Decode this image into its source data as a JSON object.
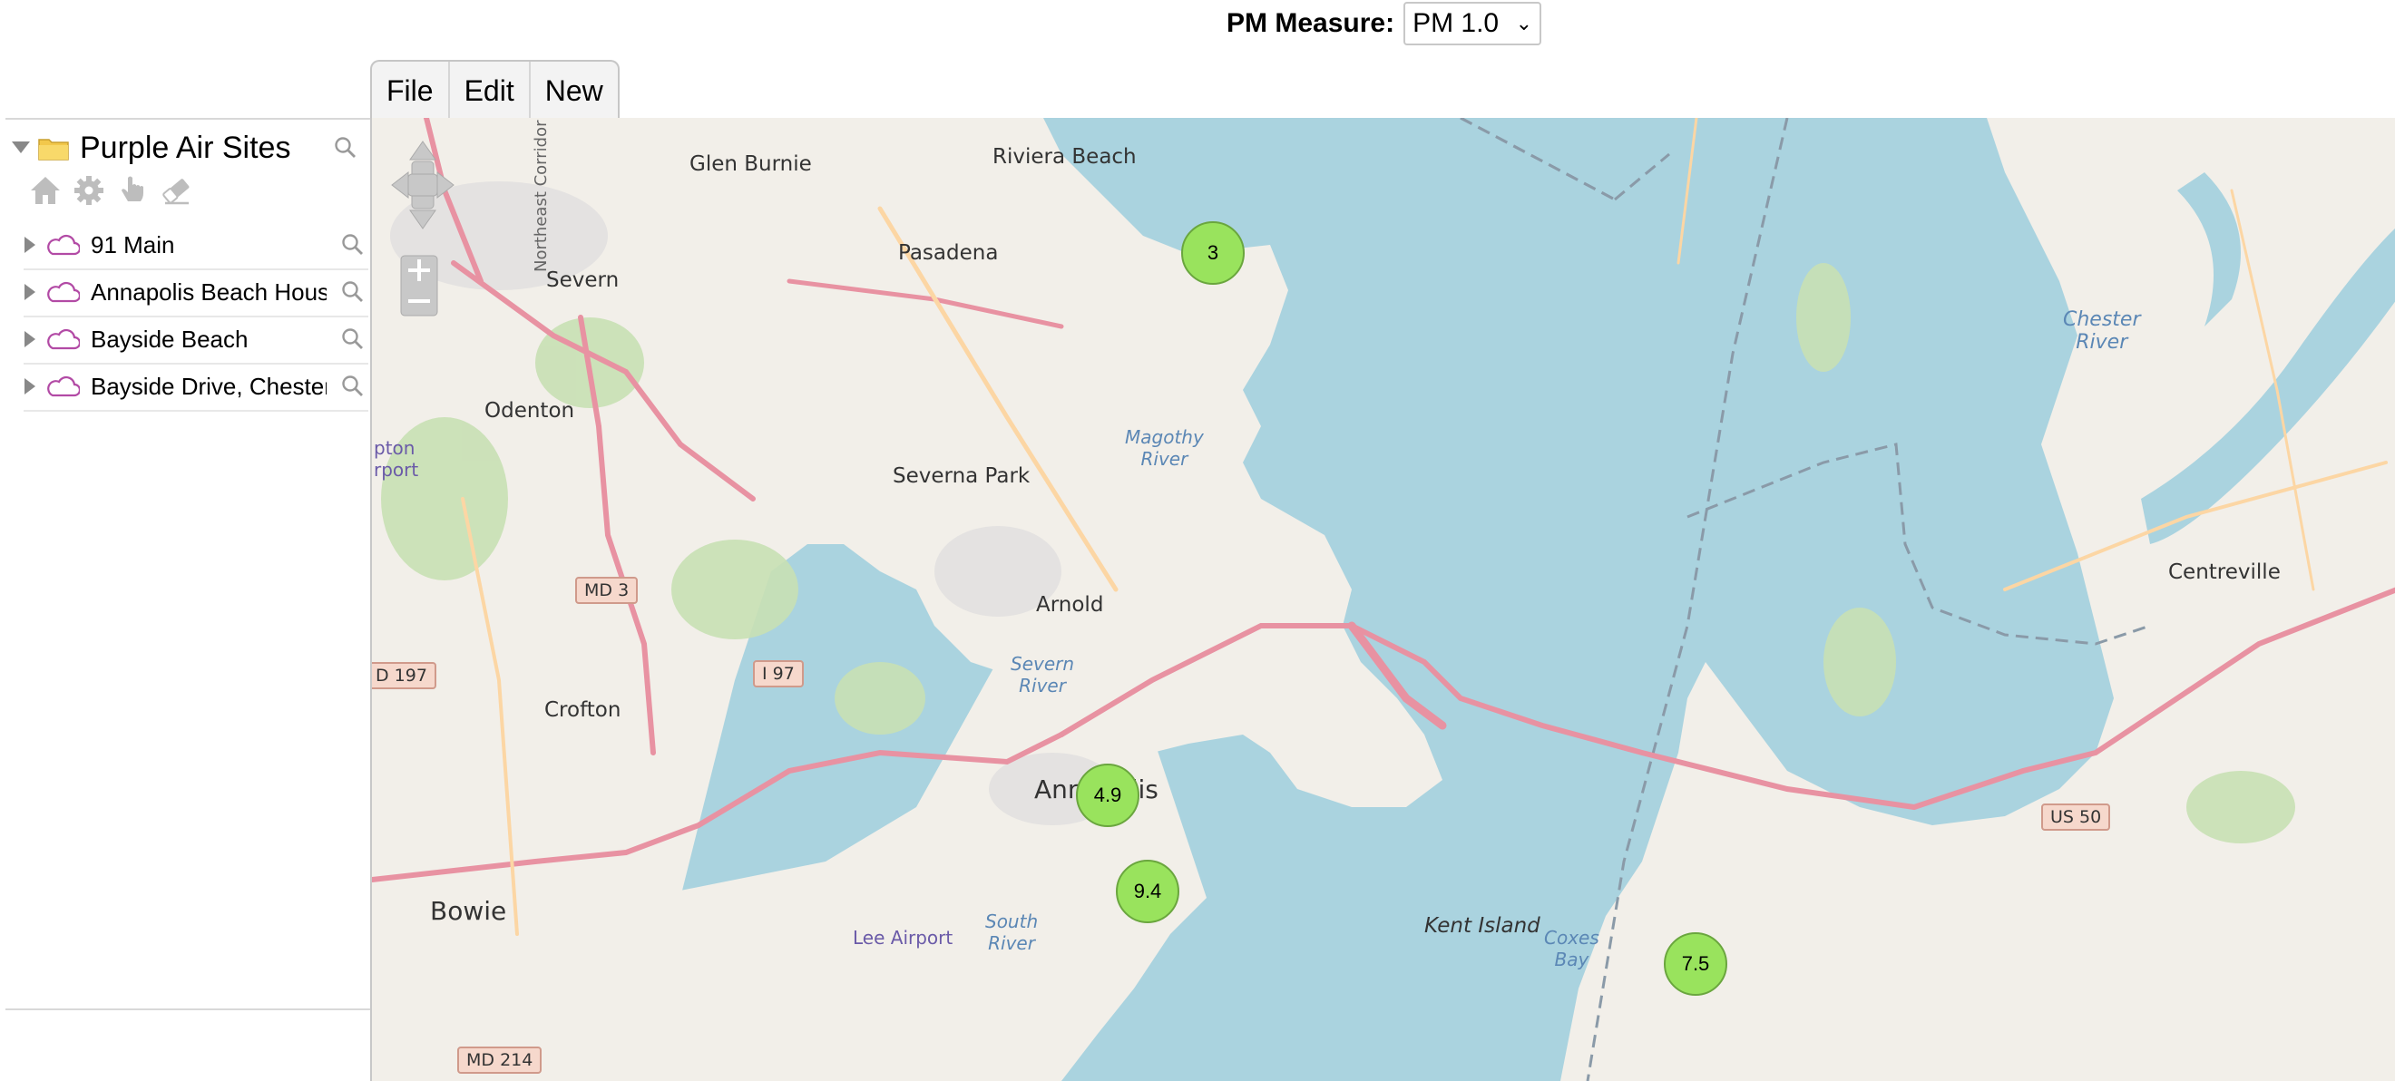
{
  "pm_measure": {
    "label": "PM Measure:",
    "selected": "PM 1.0"
  },
  "menu": {
    "items": [
      {
        "label": "File"
      },
      {
        "label": "Edit"
      },
      {
        "label": "New"
      }
    ]
  },
  "tree": {
    "root_label": "Purple Air Sites",
    "items": [
      {
        "label": "91 Main"
      },
      {
        "label": "Annapolis Beach House"
      },
      {
        "label": "Bayside Beach"
      },
      {
        "label": "Bayside Drive, Chestertown"
      }
    ]
  },
  "map": {
    "places": {
      "riviera_beach": "Riviera Beach",
      "glen_burnie": "Glen Burnie",
      "pasadena": "Pasadena",
      "severn": "Severn",
      "odenton": "Odenton",
      "severna_park": "Severna Park",
      "arnold": "Arnold",
      "crofton": "Crofton",
      "bowie": "Bowie",
      "annapolis": "Annapolis",
      "kent_island": "Kent Island",
      "centreville": "Centreville",
      "lee_airport": "Lee Airport",
      "northeast_corridor": "Northeast Corridor",
      "pton_airport": "pton\nrport"
    },
    "water": {
      "magothy": "Magothy\nRiver",
      "severn_river": "Severn\nRiver",
      "south_river": "South\nRiver",
      "chester_river": "Chester\nRiver",
      "coxes_bay": "Coxes\nBay"
    },
    "shields": {
      "md3": "MD 3",
      "i97": "I 97",
      "d197": "D 197",
      "us50": "US 50",
      "md214": "MD 214"
    },
    "markers": [
      {
        "value": "3"
      },
      {
        "value": "4.9"
      },
      {
        "value": "9.4"
      },
      {
        "value": "7.5"
      }
    ]
  },
  "colors": {
    "marker_fill": "#99e35d",
    "water": "#aad3df",
    "land": "#f2efe9",
    "motorway": "#e892a2"
  }
}
